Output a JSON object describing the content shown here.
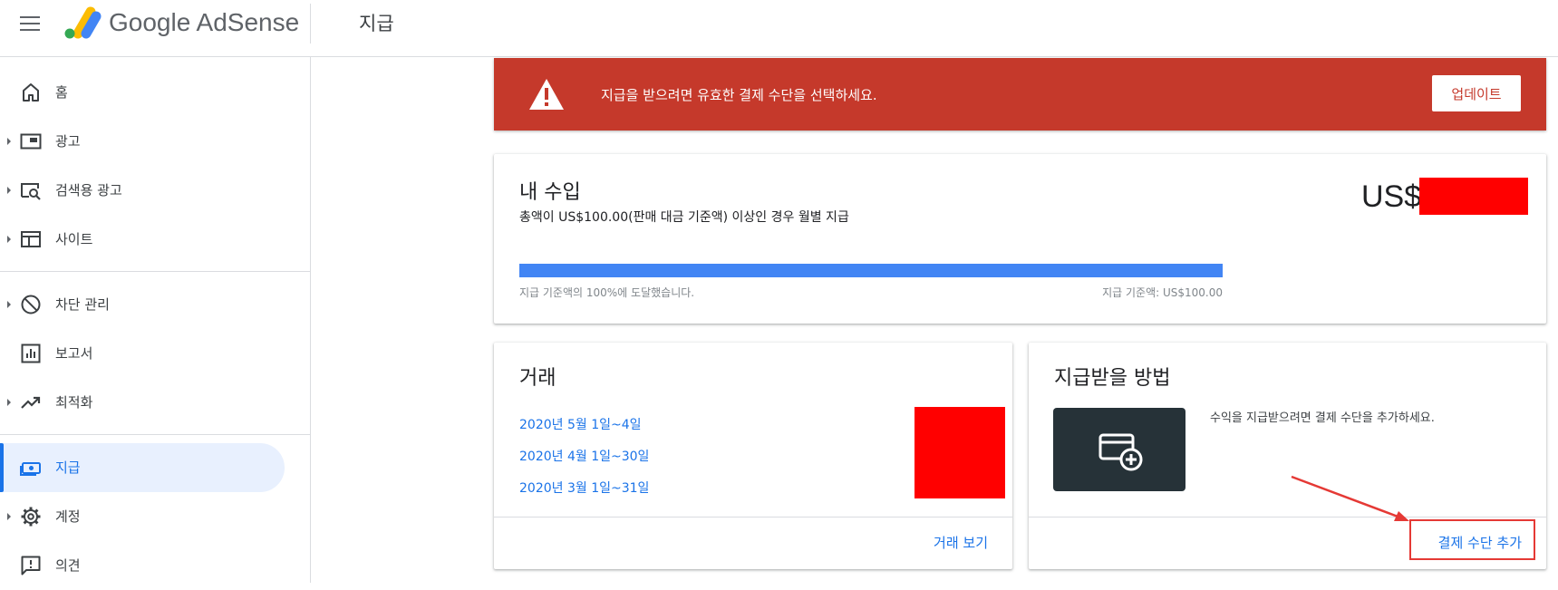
{
  "header": {
    "brand": "Google AdSense",
    "page_title": "지급"
  },
  "sidebar": {
    "items": [
      {
        "label": "홈",
        "icon": "home-icon",
        "expandable": false
      },
      {
        "label": "광고",
        "icon": "ads-icon",
        "expandable": true
      },
      {
        "label": "검색용 광고",
        "icon": "search-ads-icon",
        "expandable": true
      },
      {
        "label": "사이트",
        "icon": "sites-icon",
        "expandable": true
      },
      {
        "label": "차단 관리",
        "icon": "block-icon",
        "expandable": true
      },
      {
        "label": "보고서",
        "icon": "reports-icon",
        "expandable": false
      },
      {
        "label": "최적화",
        "icon": "trending-up-icon",
        "expandable": true
      },
      {
        "label": "지급",
        "icon": "payments-icon",
        "expandable": false,
        "active": true
      },
      {
        "label": "계정",
        "icon": "gear-icon",
        "expandable": true
      },
      {
        "label": "의견",
        "icon": "feedback-icon",
        "expandable": false
      }
    ]
  },
  "alert": {
    "message": "지급을 받으려면 유효한 결제 수단을 선택하세요.",
    "button": "업데이트",
    "icon": "warning-icon",
    "color": "#c5392b"
  },
  "earnings": {
    "title": "내 수입",
    "subtitle": "총액이 US$100.00(판매 대금 기준액) 이상인 경우 월별 지급",
    "amount_prefix": "US$",
    "progress_percent": 100,
    "progress_left": "지급 기준액의 100%에 도달했습니다.",
    "progress_right": "지급 기준액: US$100.00",
    "progress_color": "#4285f4"
  },
  "transactions": {
    "title": "거래",
    "periods": [
      "2020년 5월 1일~4일",
      "2020년 4월 1일~30일",
      "2020년 3월 1일~31일"
    ],
    "action": "거래 보기"
  },
  "payment_method": {
    "title": "지급받을 방법",
    "description": "수익을 지급받으려면 결제 수단을 추가하세요.",
    "icon": "add-card-icon",
    "action": "결제 수단 추가"
  },
  "colors": {
    "accent": "#1a73e8",
    "annotation": "#e53935",
    "redaction": "#ff0000"
  }
}
